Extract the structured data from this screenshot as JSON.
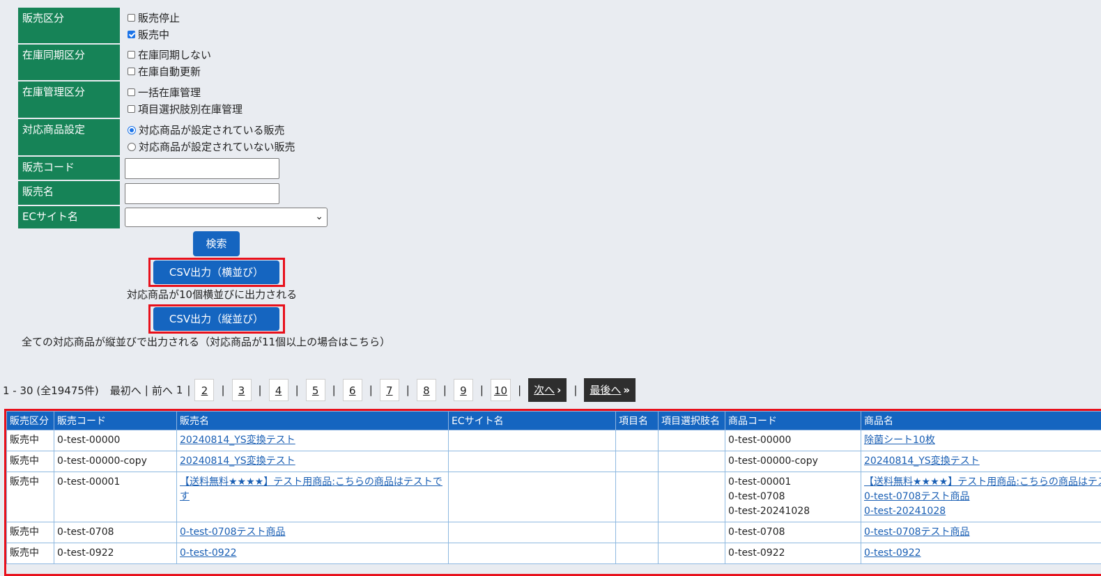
{
  "form": {
    "sales_category": {
      "label": "販売区分",
      "options": [
        {
          "label": "販売停止",
          "checked": false
        },
        {
          "label": "販売中",
          "checked": true
        }
      ]
    },
    "stock_sync": {
      "label": "在庫同期区分",
      "options": [
        {
          "label": "在庫同期しない",
          "checked": false
        },
        {
          "label": "在庫自動更新",
          "checked": false
        }
      ]
    },
    "stock_mgmt": {
      "label": "在庫管理区分",
      "options": [
        {
          "label": "一括在庫管理",
          "checked": false
        },
        {
          "label": "項目選択肢別在庫管理",
          "checked": false
        }
      ]
    },
    "product_setting": {
      "label": "対応商品設定",
      "options": [
        {
          "label": "対応商品が設定されている販売",
          "selected": true
        },
        {
          "label": "対応商品が設定されていない販売",
          "selected": false
        }
      ]
    },
    "sales_code": {
      "label": "販売コード",
      "value": ""
    },
    "sales_name": {
      "label": "販売名",
      "value": ""
    },
    "ec_site": {
      "label": "ECサイト名",
      "value": ""
    }
  },
  "buttons": {
    "search": "検索",
    "csv_horizontal": "CSV出力（横並び）",
    "csv_horizontal_note": "対応商品が10個横並びに出力される",
    "csv_vertical": "CSV出力（縦並び）",
    "csv_vertical_note": "全ての対応商品が縦並びで出力される（対応商品が11個以上の場合はこちら）"
  },
  "pagination": {
    "summary": "1 - 30 (全19475件)",
    "first": "最初へ",
    "prev": "前へ",
    "current": "1",
    "pages": [
      "2",
      "3",
      "4",
      "5",
      "6",
      "7",
      "8",
      "9",
      "10"
    ],
    "next": "次へ",
    "last": "最後へ"
  },
  "table": {
    "headers": [
      "販売区分",
      "販売コード",
      "販売名",
      "ECサイト名",
      "項目名",
      "項目選択肢名",
      "商品コード",
      "商品名"
    ],
    "rows": [
      {
        "category": "販売中",
        "code": "0-test-00000",
        "name": "20240814_YS変換テスト",
        "ec": "",
        "item": "",
        "choice": "",
        "product_codes": [
          "0-test-00000"
        ],
        "product_names": [
          "除菌シート10枚"
        ]
      },
      {
        "category": "販売中",
        "code": "0-test-00000-copy",
        "name": "20240814_YS変換テスト",
        "ec": "",
        "item": "",
        "choice": "",
        "product_codes": [
          "0-test-00000-copy"
        ],
        "product_names": [
          "20240814_YS変換テスト"
        ]
      },
      {
        "category": "販売中",
        "code": "0-test-00001",
        "name": "【送料無料★★★★】テスト用商品:こちらの商品はテストです",
        "ec": "",
        "item": "",
        "choice": "",
        "product_codes": [
          "0-test-00001",
          "0-test-0708",
          "0-test-20241028"
        ],
        "product_names": [
          "【送料無料★★★★】テスト用商品:こちらの商品はテストです",
          "0-test-0708テスト商品",
          "0-test-20241028"
        ]
      },
      {
        "category": "販売中",
        "code": "0-test-0708",
        "name": "0-test-0708テスト商品",
        "ec": "",
        "item": "",
        "choice": "",
        "product_codes": [
          "0-test-0708"
        ],
        "product_names": [
          "0-test-0708テスト商品"
        ]
      },
      {
        "category": "販売中",
        "code": "0-test-0922",
        "name": "0-test-0922",
        "ec": "",
        "item": "",
        "choice": "",
        "product_codes": [
          "0-test-0922"
        ],
        "product_names": [
          "0-test-0922"
        ]
      }
    ]
  }
}
